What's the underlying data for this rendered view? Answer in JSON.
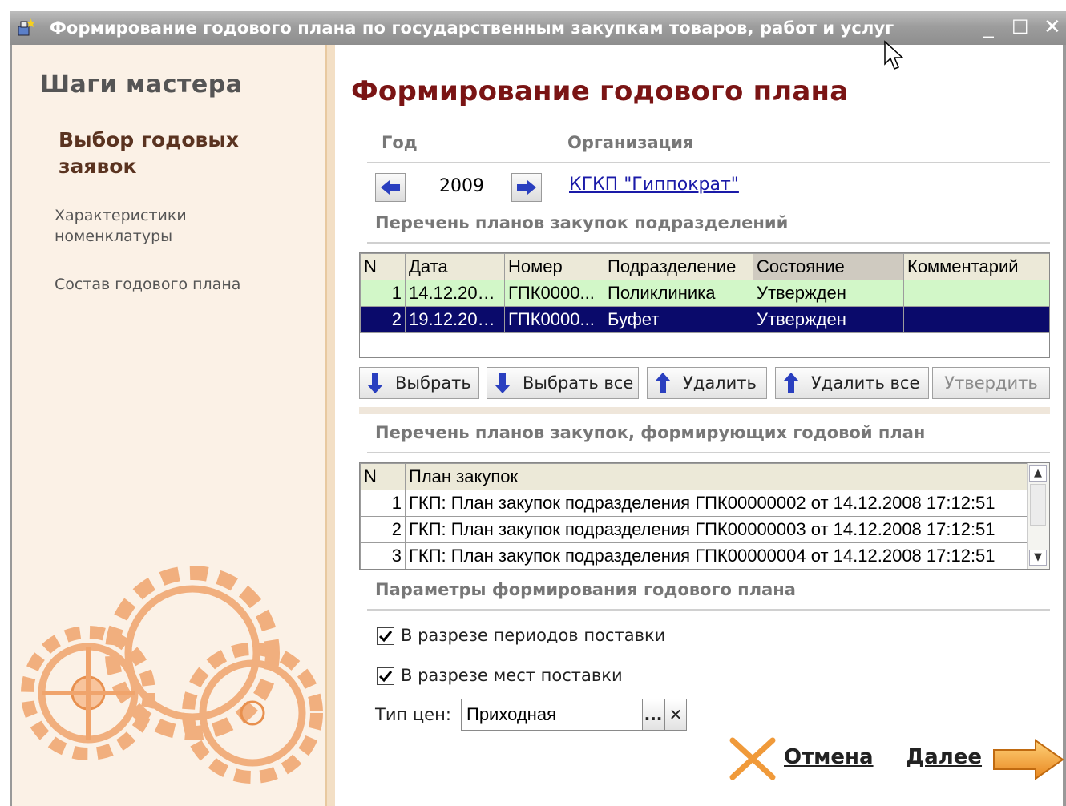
{
  "window": {
    "title": "Формирование годового плана по государственным закупкам товаров, работ и услуг",
    "controls": {
      "minimize": "_",
      "maximize": "☐",
      "close": "✕"
    }
  },
  "sidebar": {
    "title": "Шаги мастера",
    "current_step": "Выбор годовых заявок",
    "steps": [
      {
        "label": "Характеристики номенклатуры"
      },
      {
        "label": "Состав годового плана"
      }
    ]
  },
  "main": {
    "title": "Формирование годового плана",
    "year_header": "Год",
    "org_header": "Организация",
    "year_value": "2009",
    "organization": "КГКП \"Гиппократ\"",
    "dept_plans_header": "Перечень планов закупок подразделений",
    "dept_table": {
      "columns": [
        "N",
        "Дата",
        "Номер",
        "Подразделение",
        "Состояние",
        "Комментарий"
      ],
      "rows": [
        {
          "n": "1",
          "date": "14.12.200...",
          "number": "ГПК0000...",
          "dept": "Поликлиника",
          "state": "Утвержден",
          "comment": ""
        },
        {
          "n": "2",
          "date": "19.12.200...",
          "number": "ГПК0000...",
          "dept": "Буфет",
          "state": "Утвержден",
          "comment": ""
        }
      ]
    },
    "buttons": {
      "select": "Выбрать",
      "select_all": "Выбрать все",
      "delete": "Удалить",
      "delete_all": "Удалить все",
      "approve": "Утвердить"
    },
    "annual_plans_header": "Перечень планов закупок, формирующих годовой план",
    "plan_table": {
      "columns": [
        "N",
        "План закупок"
      ],
      "rows": [
        {
          "n": "1",
          "plan": "ГКП: План закупок подразделения ГПК00000002 от 14.12.2008 17:12:51"
        },
        {
          "n": "2",
          "plan": "ГКП: План закупок подразделения ГПК00000003 от 14.12.2008 17:12:51"
        },
        {
          "n": "3",
          "plan": "ГКП: План закупок подразделения ГПК00000004 от 14.12.2008 17:12:51"
        }
      ]
    },
    "params_header": "Параметры формирования годового плана",
    "checkbox_periods": "В разрезе периодов поставки",
    "checkbox_places": "В разрезе мест поставки",
    "price_type_label": "Тип цен:",
    "price_type_value": "Приходная",
    "price_select_btn": "...",
    "price_clear_btn": "✕",
    "cancel": "Отмена",
    "next": "Далее"
  },
  "colors": {
    "title_accent": "#7a1414",
    "selected_row": "#0a0a6b",
    "approved_row": "#d2f7c8",
    "link": "#1a1aa8",
    "gear_color": "#f5a36a"
  }
}
